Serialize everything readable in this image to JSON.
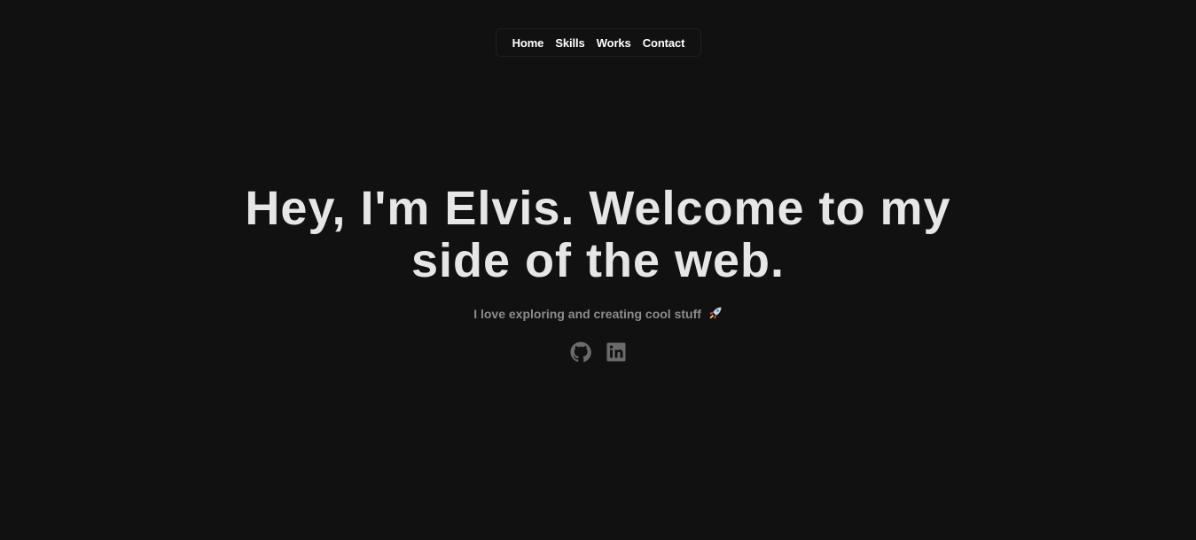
{
  "nav": {
    "items": [
      {
        "label": "Home"
      },
      {
        "label": "Skills"
      },
      {
        "label": "Works"
      },
      {
        "label": "Contact"
      }
    ]
  },
  "hero": {
    "headline": "Hey, I'm Elvis. Welcome to my side of the web.",
    "tagline": "I love exploring and creating cool stuff",
    "tagline_emoji_icon": "rocket-icon"
  },
  "socials": [
    {
      "icon": "github-icon"
    },
    {
      "icon": "linkedin-icon"
    }
  ],
  "colors": {
    "background": "#111111",
    "headline": "#e6e6e6",
    "tagline": "#8c8c8c",
    "icons": "#6b6b6b",
    "nav_text": "#ffffff"
  }
}
